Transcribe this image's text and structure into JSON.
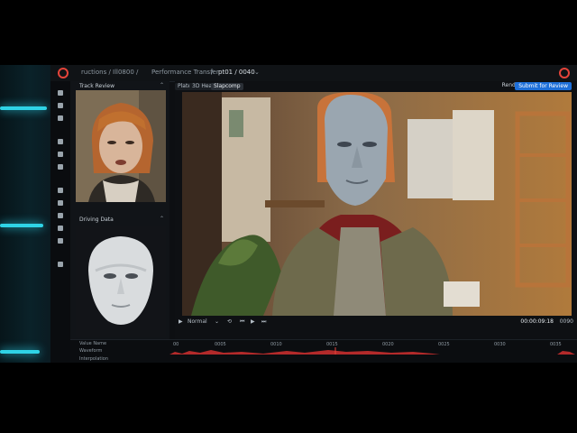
{
  "breadcrumb": {
    "items": [
      "Performance Transfer",
      "pt01 / 0040"
    ],
    "separator": "/",
    "faded_prefix": "ructions / Ill0800 /"
  },
  "panels": {
    "track_review": "Track Review",
    "driving_data": "Driving Data"
  },
  "viewer": {
    "tabs": [
      "Plate",
      "3D Head",
      "Slapcomp"
    ],
    "active_tab": "Slapcomp",
    "render_label": "Render",
    "submit_label": "Submit for Review"
  },
  "playback": {
    "mode": "Normal",
    "timecode": "00:00:09:18",
    "end_frame": "0090"
  },
  "timeline": {
    "ticks": [
      "00",
      "0005",
      "0010",
      "0015",
      "0020",
      "0025",
      "0030",
      "0035"
    ],
    "rows": [
      "Value Name",
      "Waveform",
      "Interpolation"
    ]
  },
  "colors": {
    "accent_red": "#e5443a",
    "accent_blue": "#1e6fd9",
    "glow_cyan": "#2fd3e6",
    "waveform_red": "#b32a2a"
  }
}
